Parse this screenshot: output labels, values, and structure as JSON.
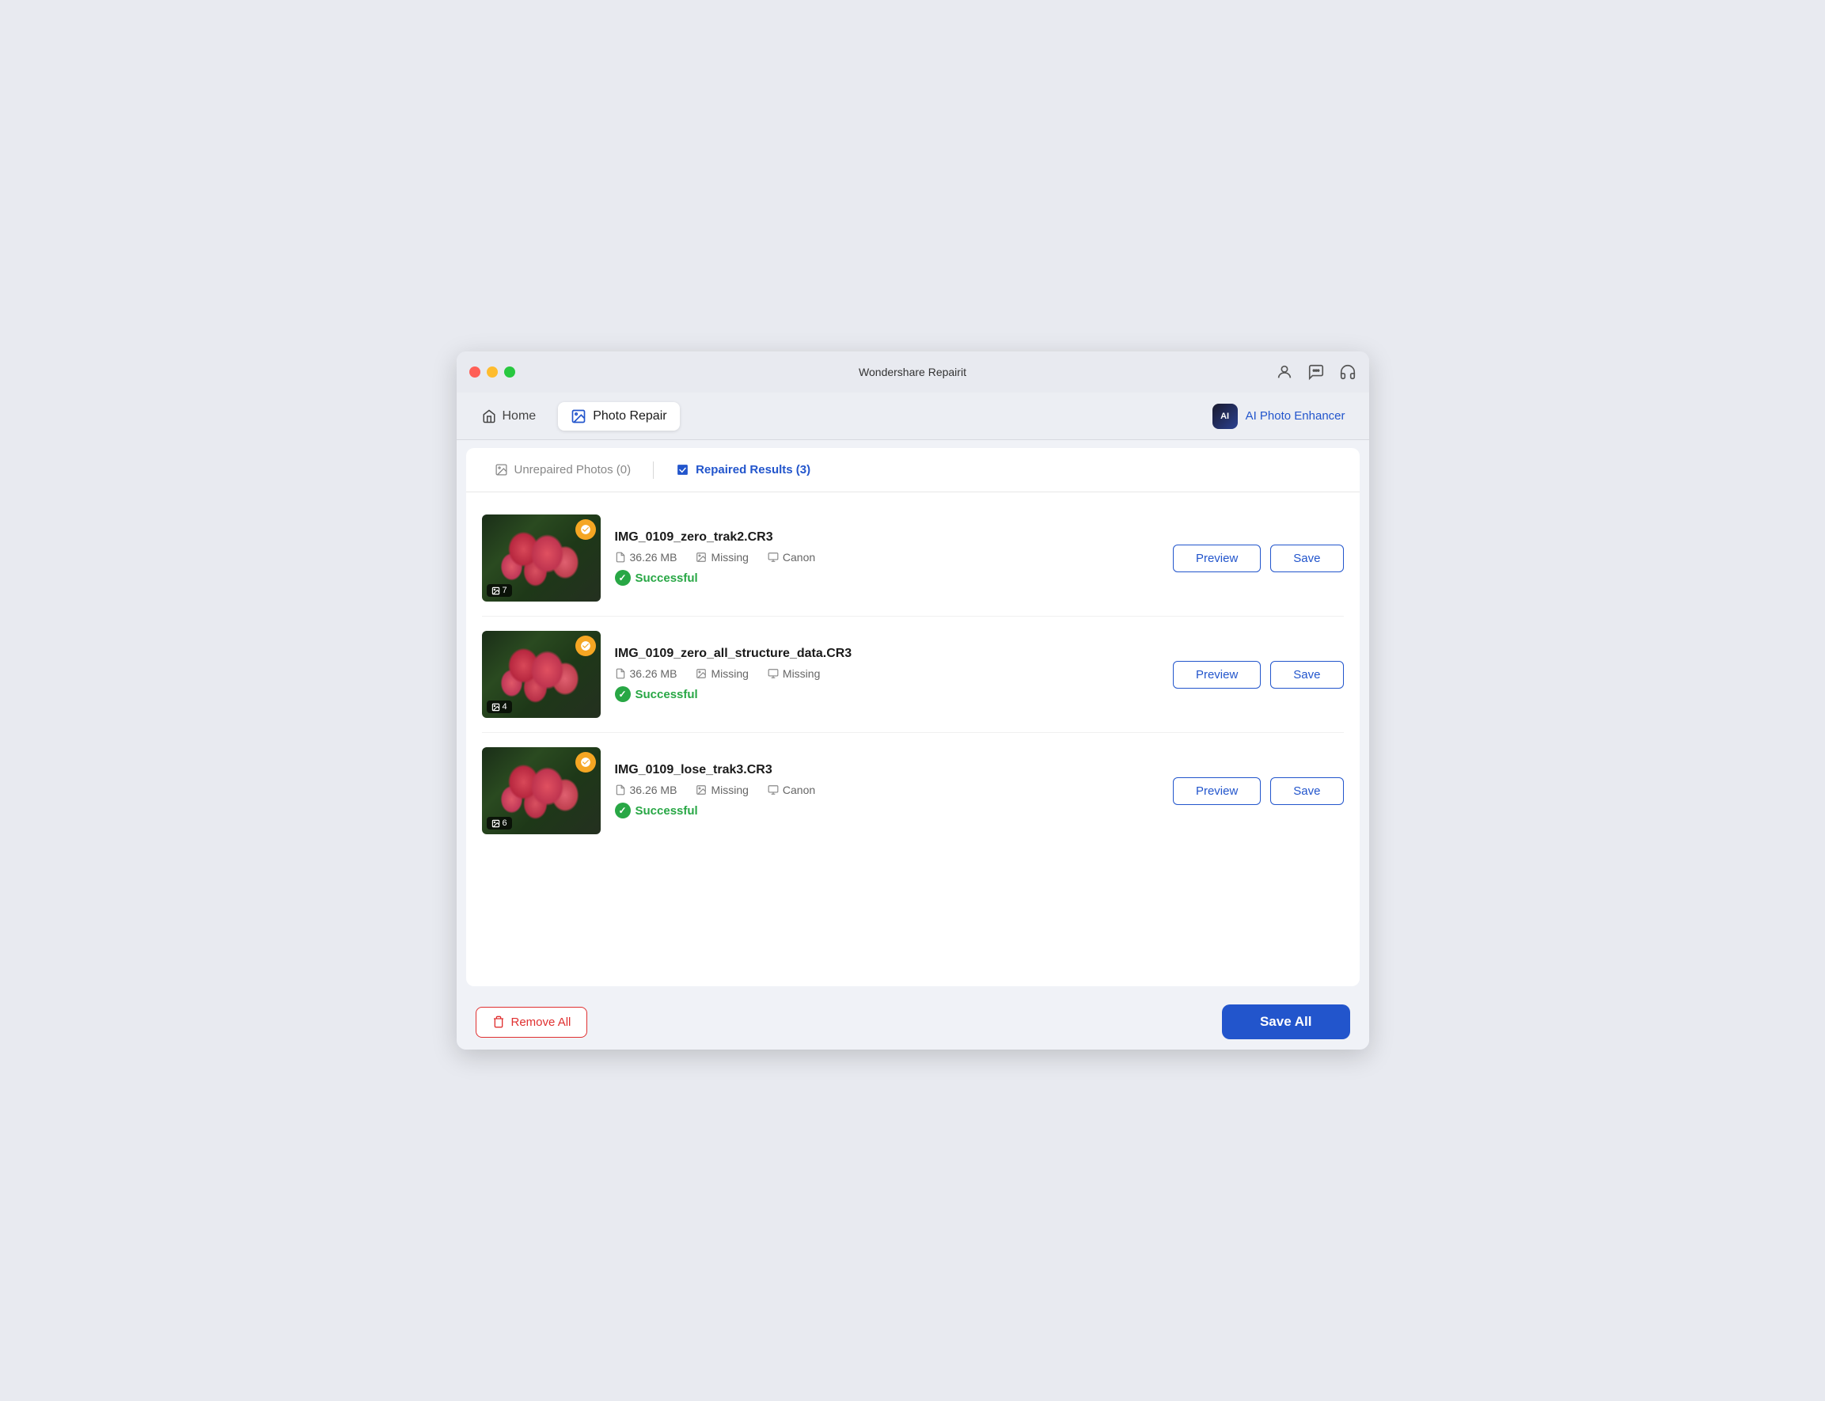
{
  "app": {
    "title": "Wondershare Repairit"
  },
  "toolbar": {
    "home_label": "Home",
    "photo_repair_label": "Photo Repair",
    "ai_enhancer_label": "AI Photo Enhancer",
    "ai_badge": "AI"
  },
  "tabs": {
    "unrepaired": "Unrepaired Photos (0)",
    "repaired": "Repaired Results (3)"
  },
  "items": [
    {
      "name": "IMG_0109_zero_trak2.CR3",
      "size": "36.26 MB",
      "field1": "Missing",
      "field2": "Canon",
      "status": "Successful",
      "badge_num": "7"
    },
    {
      "name": "IMG_0109_zero_all_structure_data.CR3",
      "size": "36.26 MB",
      "field1": "Missing",
      "field2": "Missing",
      "status": "Successful",
      "badge_num": "4"
    },
    {
      "name": "IMG_0109_lose_trak3.CR3",
      "size": "36.26 MB",
      "field1": "Missing",
      "field2": "Canon",
      "status": "Successful",
      "badge_num": "6"
    }
  ],
  "buttons": {
    "preview": "Preview",
    "save": "Save",
    "remove_all": "Remove All",
    "save_all": "Save All"
  }
}
